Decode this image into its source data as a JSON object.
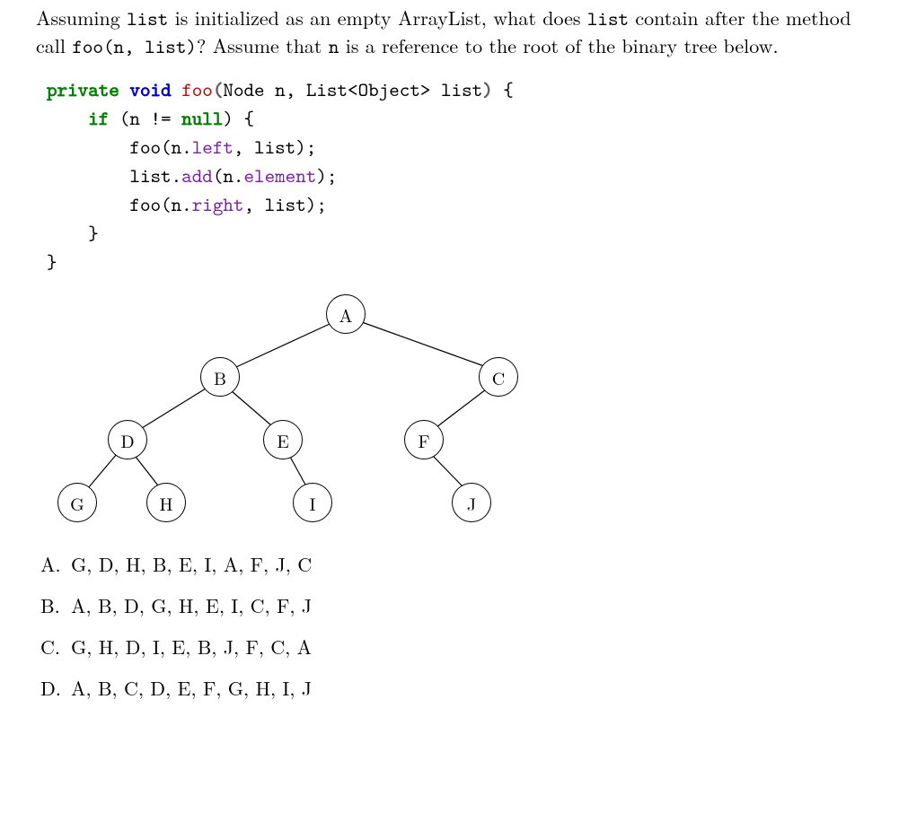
{
  "question": {
    "pre1": "Assuming ",
    "tt1": "list",
    "mid1": " is initialized as an empty ArrayList, what does ",
    "tt2": "list",
    "mid2": " contain after the method call ",
    "tt3": "foo(n, list)",
    "mid3": "? Assume that ",
    "tt4": "n",
    "post": " is a reference to the root of the binary tree below."
  },
  "code": {
    "kw_private": "private",
    "kw_void": "void",
    "fn_foo": "foo",
    "lparen": "(",
    "type_node": "Node",
    "param_n": " n, ",
    "type_list": "List<Object>",
    "param_list": " list",
    "rparen": ")",
    "lbrace": " {",
    "kw_if": "if",
    "cond_open": " (",
    "cond_body_a": "n != ",
    "kw_null": "null",
    "cond_close": ")",
    "lbrace2": " {",
    "call1_a": "foo(n.",
    "field_left": "left",
    "call1_b": ", list);",
    "call2_a": "list.",
    "field_add": "add",
    "call2_b": "(n.",
    "field_element": "element",
    "call2_c": ");",
    "call3_a": "foo(n.",
    "field_right": "right",
    "call3_b": ", list);",
    "rbrace1": "}",
    "rbrace2": "}"
  },
  "tree": {
    "A": "A",
    "B": "B",
    "C": "C",
    "D": "D",
    "E": "E",
    "F": "F",
    "G": "G",
    "H": "H",
    "I": "I",
    "J": "J"
  },
  "choices": {
    "A": {
      "letter": "A.",
      "text": "G, D, H, B, E, I, A, F, J, C"
    },
    "B": {
      "letter": "B.",
      "text": "A, B, D, G, H, E, I, C, F, J"
    },
    "C": {
      "letter": "C.",
      "text": "G, H, D, I, E, B, J, F, C, A"
    },
    "D": {
      "letter": "D.",
      "text": "A, B, C, D, E, F, G, H, I, J"
    }
  }
}
